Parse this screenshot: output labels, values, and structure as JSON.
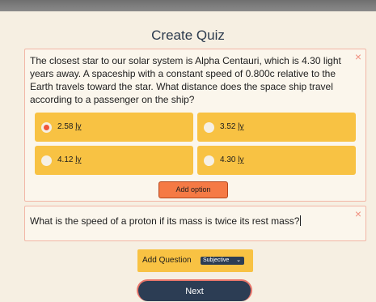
{
  "page": {
    "title": "Create Quiz"
  },
  "questions": [
    {
      "text": "The closest star to our solar system is Alpha Centauri, which is 4.30 light years away. A spaceship with a constant speed of 0.800c relative to the Earth travels toward the star. What distance does the space ship travel according to a passenger on the ship?",
      "close_icon": "×",
      "options": [
        {
          "value": "2.58",
          "unit": "ly",
          "selected": true
        },
        {
          "value": "3.52",
          "unit": "ly",
          "selected": false
        },
        {
          "value": "4.12",
          "unit": "ly",
          "selected": false
        },
        {
          "value": "4.30",
          "unit": "ly",
          "selected": false
        }
      ],
      "add_option_label": "Add option"
    },
    {
      "text": "What is the speed of a proton if its mass is twice its rest mass?",
      "close_icon": "×"
    }
  ],
  "add_question": {
    "label": "Add Question",
    "type_selected": "Subjective"
  },
  "next_label": "Next",
  "icons": {
    "close": "close-icon",
    "radio": "radio-icon",
    "chevron": "chevron-down-icon"
  },
  "colors": {
    "accent": "#f8c243",
    "primary": "#2c3d54",
    "danger": "#f0553b",
    "add_option": "#f57a45"
  }
}
